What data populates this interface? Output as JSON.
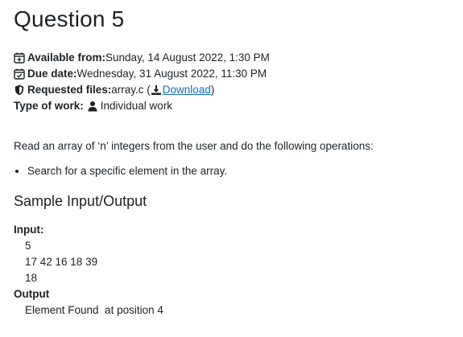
{
  "title": "Question 5",
  "meta": {
    "available_label": "Available from:",
    "available_value": " Sunday, 14 August 2022, 1:30 PM",
    "due_label": "Due date:",
    "due_value": " Wednesday, 31 August 2022, 11:30 PM",
    "files_label": "Requested files:",
    "files_value": " array.c (",
    "files_download": "Download",
    "files_close": ")",
    "type_label": "Type of work:",
    "type_value": "Individual work"
  },
  "description": "Read an array of ‘n’ integers from the user and do the following operations:",
  "operations": [
    "Search for a specific element in the array."
  ],
  "sample_heading": "Sample Input/Output",
  "input": {
    "label": "Input:",
    "lines": [
      "5",
      "17 42 16 18 39",
      "18"
    ]
  },
  "output": {
    "label": "Output",
    "lines": [
      "Element Found  at position 4"
    ]
  },
  "icons": {
    "calendar_plus": "calendar-plus-icon",
    "calendar_check": "calendar-check-icon",
    "shield": "shield-icon",
    "download": "download-icon",
    "user": "user-icon"
  },
  "colors": {
    "text": "#1d2125",
    "link": "#0f6cbf"
  }
}
